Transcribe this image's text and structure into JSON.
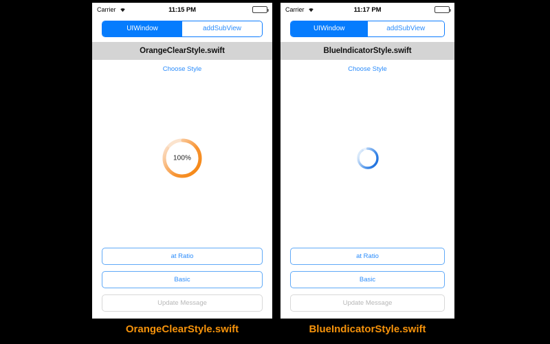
{
  "background_color": "#000000",
  "accent_blue": "#067cfd",
  "accent_orange": "#f5920b",
  "titlebar_gray": "#d4d4d4",
  "phones": [
    {
      "id": "orange-clear-style",
      "statusbar": {
        "carrier": "Carrier",
        "wifi_icon": "wifi-icon",
        "time": "11:15 PM",
        "battery_icon": "battery-full-icon"
      },
      "segmented": {
        "options": [
          "UIWindow",
          "addSubView"
        ],
        "selected_index": 0
      },
      "title": "OrangeClearStyle.swift",
      "choose_style_label": "Choose Style",
      "indicator": {
        "style": "orange-clear",
        "type": "determinate-ring",
        "progress_label": "100%",
        "progress_value": 100,
        "track_color": "#fbe0c6",
        "arc_color_start": "#f5850d",
        "arc_color_end": "#fbd9bb",
        "sweep_degrees": 300
      },
      "buttons": [
        {
          "label": "at Ratio",
          "state": "enabled"
        },
        {
          "label": "Basic",
          "state": "enabled"
        },
        {
          "label": "Update Message",
          "state": "disabled"
        }
      ],
      "caption": "OrangeClearStyle.swift"
    },
    {
      "id": "blue-indicator-style",
      "statusbar": {
        "carrier": "Carrier",
        "wifi_icon": "wifi-icon",
        "time": "11:17 PM",
        "battery_icon": "battery-full-icon"
      },
      "segmented": {
        "options": [
          "UIWindow",
          "addSubView"
        ],
        "selected_index": 0
      },
      "title": "BlueIndicatorStyle.swift",
      "choose_style_label": "Choose Style",
      "indicator": {
        "style": "blue-indicator",
        "type": "indeterminate-spinner",
        "progress_label": "",
        "progress_value": null,
        "track_color": "#e8f2fd",
        "arc_color_start": "#1266d8",
        "arc_color_end": "#cfe4fa",
        "sweep_degrees": 330
      },
      "buttons": [
        {
          "label": "at Ratio",
          "state": "enabled"
        },
        {
          "label": "Basic",
          "state": "enabled"
        },
        {
          "label": "Update Message",
          "state": "disabled"
        }
      ],
      "caption": "BlueIndicatorStyle.swift"
    }
  ]
}
